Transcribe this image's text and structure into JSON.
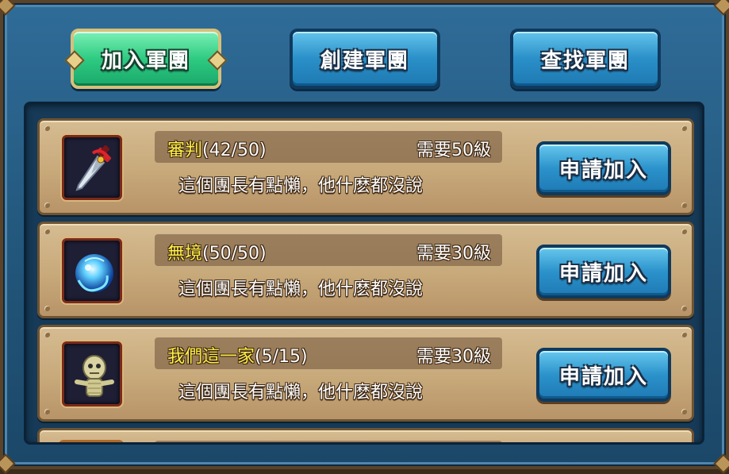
{
  "tabs": [
    {
      "label": "加入軍團",
      "active": true
    },
    {
      "label": "創建軍團",
      "active": false
    },
    {
      "label": "查找軍團",
      "active": false
    }
  ],
  "guilds": [
    {
      "emblem_icon": "dagger-icon",
      "name": "審判",
      "members": "(42/50)",
      "requirement": "需要50級",
      "description": "這個團長有點懶，他什麽都沒說",
      "button": "申請加入"
    },
    {
      "emblem_icon": "blue-orb-icon",
      "name": "無境",
      "members": "(50/50)",
      "requirement": "需要30級",
      "description": "這個團長有點懶，他什麽都沒說",
      "button": "申請加入"
    },
    {
      "emblem_icon": "voodoo-doll-icon",
      "name": "我們這一家",
      "members": "(5/15)",
      "requirement": "需要30級",
      "description": "這個團長有點懶，他什麽都沒說",
      "button": "申請加入"
    }
  ],
  "colors": {
    "active_tab": "#2ecb82",
    "tab": "#2a8fc8",
    "guild_name": "#fff04a",
    "row_bg": "#c7a97a",
    "panel_bg": "#215478"
  }
}
